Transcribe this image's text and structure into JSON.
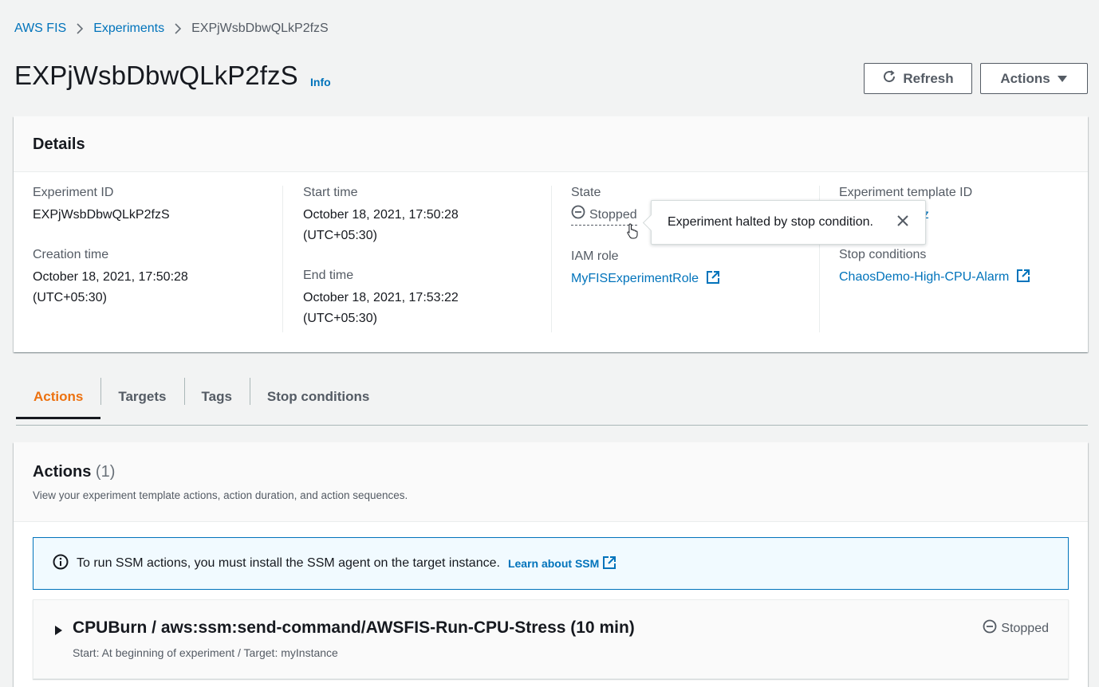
{
  "breadcrumb": {
    "root": "AWS FIS",
    "experiments": "Experiments",
    "current": "EXPjWsbDbwQLkP2fzS"
  },
  "header": {
    "title": "EXPjWsbDbwQLkP2fzS",
    "info": "Info",
    "refresh_label": "Refresh",
    "actions_label": "Actions"
  },
  "details": {
    "title": "Details",
    "experiment_id_label": "Experiment ID",
    "experiment_id": "EXPjWsbDbwQLkP2fzS",
    "creation_time_label": "Creation time",
    "creation_time_line1": "October 18, 2021, 17:50:28",
    "creation_time_line2": "(UTC+05:30)",
    "start_time_label": "Start time",
    "start_time_line1": "October 18, 2021, 17:50:28",
    "start_time_line2": "(UTC+05:30)",
    "end_time_label": "End time",
    "end_time_line1": "October 18, 2021, 17:53:22",
    "end_time_line2": "(UTC+05:30)",
    "state_label": "State",
    "state": "Stopped",
    "iam_role_label": "IAM role",
    "iam_role": "MyFISExperimentRole",
    "template_id_label": "Experiment template ID",
    "template_id": "EXT...NCSd9Vz",
    "stop_conditions_label": "Stop conditions",
    "stop_condition": "ChaosDemo-High-CPU-Alarm"
  },
  "tooltip": {
    "text": "Experiment halted by stop condition."
  },
  "tabs": [
    {
      "label": "Actions",
      "active": true
    },
    {
      "label": "Targets",
      "active": false
    },
    {
      "label": "Tags",
      "active": false
    },
    {
      "label": "Stop conditions",
      "active": false
    }
  ],
  "actions_section": {
    "title": "Actions",
    "count": "(1)",
    "description": "View your experiment template actions, action duration, and action sequences.",
    "alert_text": "To run SSM actions, you must install the SSM agent on the target instance.",
    "alert_link": "Learn about SSM",
    "item": {
      "title": "CPUBurn / aws:ssm:send-command/AWSFIS-Run-CPU-Stress (10 min)",
      "subtitle": "Start: At beginning of experiment / Target: myInstance",
      "status": "Stopped"
    }
  },
  "colors": {
    "link": "#0073bb",
    "active_tab": "#ec7211",
    "text": "#16191f",
    "muted": "#545b64"
  },
  "icons": [
    "chevron-right-icon",
    "refresh-icon",
    "caret-down-icon",
    "stopped-icon",
    "external-link-icon",
    "close-icon",
    "info-icon",
    "caret-right-icon",
    "pointer-cursor-icon"
  ]
}
